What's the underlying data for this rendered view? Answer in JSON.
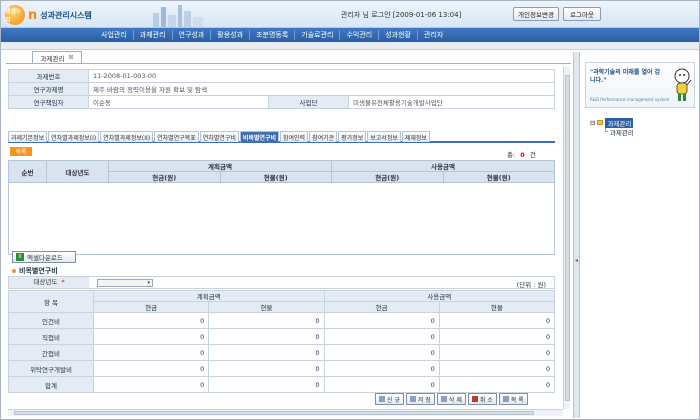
{
  "header": {
    "logo_badge": "생생누리",
    "logo_letter": "n",
    "system_name": "성과관리시스템",
    "user_info": "관리자 님 로그인 [2009-01-06 13:04]",
    "profile_button": "개인정보변경",
    "logout_button": "로그아웃"
  },
  "nav": {
    "items": [
      "사업관리",
      "과제관리",
      "연구성과",
      "활용성과",
      "조분명동록",
      "기술료관리",
      "수익관리",
      "성과현황",
      "관리자"
    ]
  },
  "page_tab": {
    "label": "과제관리",
    "close": "⊠"
  },
  "info": {
    "task_no_label": "과제번호",
    "task_no": "11-2008-01-003-00",
    "task_name_label": "연구과제명",
    "task_name": "제주 바람의 정력이용을 자원 확보 및 탐색",
    "manager_label": "연구책임자",
    "manager": "이순동",
    "org_label": "사업단",
    "org": "미생물유전체활용기술개발사업단"
  },
  "subtabs": {
    "items": [
      "과제기본정보",
      "연차별과제정보(I)",
      "연차별과제정보(II)",
      "연차별연구목표",
      "연차별연구비",
      "비목별연구비",
      "참여인력",
      "참여기관",
      "평가정보",
      "보고서정보",
      "제재정보"
    ],
    "active_index": 5
  },
  "list_section": {
    "tag": "목록",
    "count_label": "총:",
    "count": "0",
    "count_unit": "건",
    "headers": {
      "seq": "순번",
      "year": "대상년도",
      "planned": "계획금액",
      "used": "사용금액",
      "cash": "현금(원)",
      "kind": "현물(원)"
    }
  },
  "excel_button": "엑셀다운로드",
  "detail": {
    "title": "비목별연구비",
    "year_label": "대상년도",
    "required_mark": "*",
    "unit": "(단위 : 원)",
    "headers": {
      "item": "항 목",
      "planned": "계획금액",
      "used": "사용금액",
      "cash": "현금",
      "kind": "현물"
    },
    "rows": [
      {
        "label": "인건비",
        "values": [
          "0",
          "0",
          "0",
          "0"
        ]
      },
      {
        "label": "직접비",
        "values": [
          "0",
          "0",
          "0",
          "0"
        ]
      },
      {
        "label": "간접비",
        "values": [
          "0",
          "0",
          "0",
          "0"
        ]
      },
      {
        "label": "위탁연구개발비",
        "values": [
          "0",
          "0",
          "0",
          "0"
        ]
      },
      {
        "label": "합계",
        "values": [
          "0",
          "0",
          "0",
          "0"
        ]
      }
    ]
  },
  "buttons": {
    "new": "신 규",
    "save": "저 장",
    "delete": "삭 제",
    "cancel": "취 소",
    "list": "목 록"
  },
  "right_panel": {
    "promo_text": "\"과학기술의 미래를 열어 갑니다.\"",
    "promo_small": "R&D Performance management system",
    "tree_root": "과제관리",
    "tree_child": "과제관리"
  },
  "colors": {
    "nav_blue": "#2b5ea6",
    "accent_orange": "#f7941d",
    "header_light": "#d9e6f4"
  }
}
